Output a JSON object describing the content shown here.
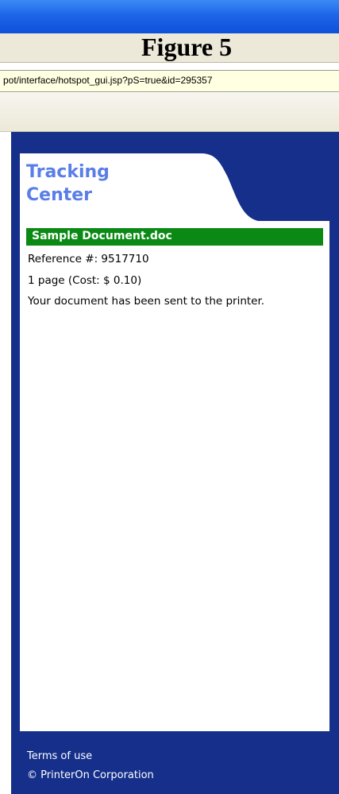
{
  "figure_label": "Figure 5",
  "address_bar": {
    "url": "pot/interface/hotspot_gui.jsp?pS=true&id=295357"
  },
  "header": {
    "title_line1": "Tracking",
    "title_line2": "Center"
  },
  "document": {
    "name": "Sample Document.doc",
    "reference": "Reference #: 9517710",
    "pages_cost": "1 page (Cost: $ 0.10)",
    "status": "Your document has been sent to the printer."
  },
  "footer": {
    "terms_label": "Terms of use",
    "copyright": "© PrinterOn Corporation"
  },
  "colors": {
    "sidebar_bg": "#152f8a",
    "title_color": "#5a7ee8",
    "doc_header_bg": "#0a8a14"
  }
}
